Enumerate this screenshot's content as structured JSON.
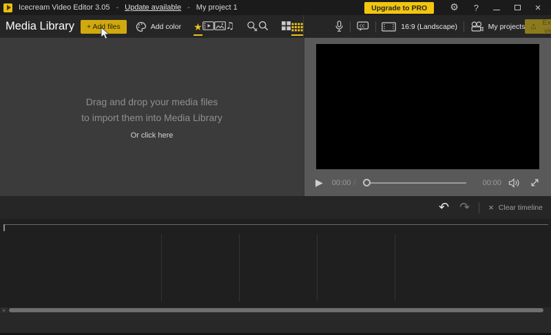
{
  "titlebar": {
    "app_title": "Icecream Video Editor 3.05",
    "dash1": "-",
    "update_link": "Update available",
    "dash2": "-",
    "project_name": "My project 1",
    "upgrade_button": "Upgrade to PRO"
  },
  "icons": {
    "gear": "⚙",
    "help": "?",
    "close": "×",
    "star": "★",
    "music": "♫",
    "play": "▶",
    "undo": "↶",
    "redo": "↷",
    "clear_x": "×",
    "cc_label": "cc"
  },
  "library": {
    "title": "Media Library",
    "add_files": "+ Add files",
    "add_color": "Add color",
    "drop_line1": "Drag and drop your media files",
    "drop_line2": "to import them into Media Library",
    "drop_click": "Or click here"
  },
  "preview": {
    "aspect": "16:9 (Landscape)",
    "my_projects": "My projects",
    "export": "Export video",
    "time_current": "00:00",
    "time_sep": "/",
    "time_total": "00:00"
  },
  "timeline": {
    "clear": "Clear timeline"
  },
  "colors": {
    "accent_yellow": "#f0c419",
    "upgrade_button_bg": "#f2c60f",
    "add_files_button_bg": "#d1a90e",
    "export_disabled_bg": "#8b7b1e",
    "export_disabled_text": "#574a0e",
    "library_panel_bg": "#3b3b3b",
    "preview_panel_bg": "#595959"
  }
}
